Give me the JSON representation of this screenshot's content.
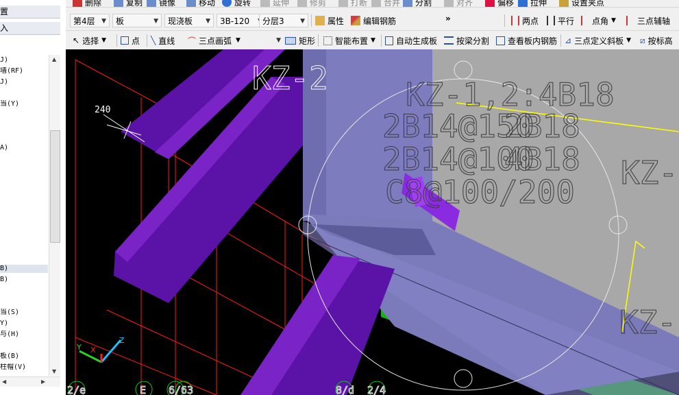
{
  "sidebar": {
    "header_top": "置",
    "header_second": "入",
    "items": [
      "J)",
      "墙(RF)",
      "J)",
      "当(Y)",
      "A)",
      "B)",
      "B)",
      "当(S)",
      "Y)",
      "与(H)",
      "板(B)",
      "柱帽(V)"
    ]
  },
  "toolbar_row1": {
    "items": [
      "删除",
      "复制",
      "镜像",
      "移动",
      "旋转",
      "延伸",
      "修剪",
      "打断",
      "合并",
      "分割",
      "对齐",
      "偏移",
      "拉伸",
      "设置夹点"
    ]
  },
  "toolbar_row2": {
    "floor": "第4层",
    "category": "板",
    "type": "现浇板",
    "element": "3B-120",
    "layer": "分层3",
    "properties": "属性",
    "edit_rebar": "编辑钢筋",
    "more": "»",
    "two_point": "两点",
    "parallel": "平行",
    "point_angle": "点角",
    "three_point_axis": "三点辅轴"
  },
  "toolbar_row3": {
    "select": "选择",
    "point": "点",
    "line": "直线",
    "arc": "三点画弧",
    "rect": "矩形",
    "smart_place": "智能布置",
    "auto_generate": "自动生成板",
    "split_by_beam": "按梁分割",
    "view_rebar": "查看板内钢筋",
    "three_point_slope": "三点定义斜板",
    "by_elevation": "按标高"
  },
  "canvas": {
    "labels": {
      "kz2_top": "KZ-2",
      "kz1_spec": "KZ-1,2:4B18",
      "overlap1": "2B14@150",
      "overlap2": "2B18",
      "overlap3": "2B14@100",
      "overlap4": "4B18",
      "stirrup": "C8@100/200",
      "kz_right": "KZ-",
      "kz_bottom_right": "KZ-",
      "small_dim": "240"
    },
    "axis_labels": [
      "2/e",
      "E",
      "6/63",
      "8/d",
      "2/4"
    ],
    "axis_colors": {
      "x": "#ff2020",
      "y": "#2060ff",
      "z": "#20c0ff"
    }
  },
  "colors": {
    "purple": "#5b12a6",
    "slab_grey": "#a8a8a8",
    "column_blue": "#7c7cc0",
    "green": "#0fb00f",
    "yellow": "#ffff00",
    "red": "#ff0000"
  }
}
